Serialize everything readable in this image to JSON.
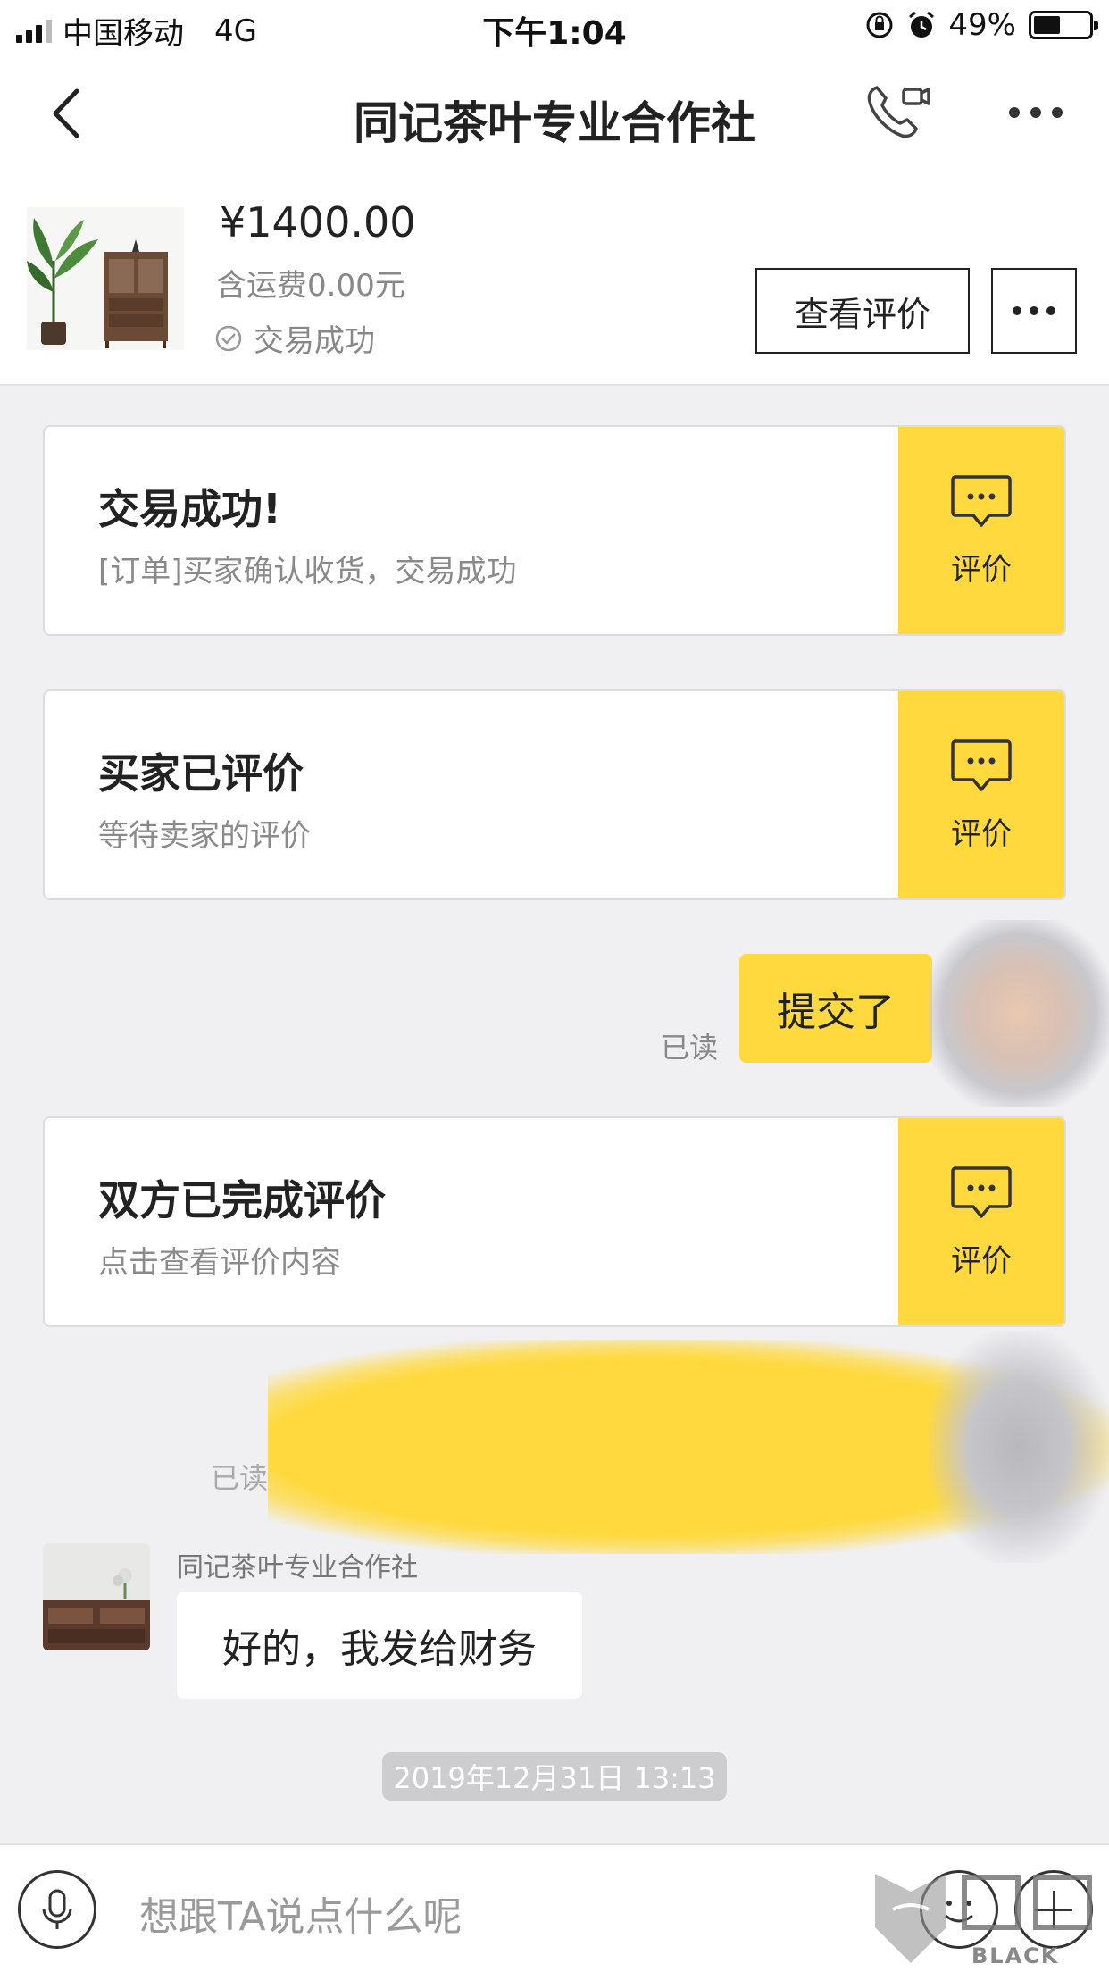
{
  "status_bar": {
    "carrier": "中国移动",
    "network": "4G",
    "time": "下午1:04",
    "battery": "49%",
    "battery_level": 0.49
  },
  "nav": {
    "title": "同记茶叶专业合作社",
    "icons": [
      "back-arrow-icon",
      "phone-video-icon",
      "more-icon"
    ]
  },
  "product": {
    "price": "¥1400.00",
    "shipping": "含运费0.00元",
    "status": "交易成功",
    "review_button": "查看评价"
  },
  "colors": {
    "accent": "#ffd93d",
    "background": "#f0f0f3"
  },
  "cards": [
    {
      "title": "交易成功!",
      "subtitle": "[订单]买家确认收货，交易成功",
      "action": "评价"
    },
    {
      "title": "买家已评价",
      "subtitle": "等待卖家的评价",
      "action": "评价"
    },
    {
      "title": "双方已完成评价",
      "subtitle": "点击查看评价内容",
      "action": "评价"
    }
  ],
  "chat": {
    "my_message": "提交了",
    "read_label": "已读",
    "read_label_2": "已读",
    "sender_name": "同记茶叶专业合作社",
    "other_message": "好的，我发给财务",
    "timestamp": "2019年12月31日 13:13"
  },
  "input": {
    "placeholder": "想跟TA说点什么呢"
  },
  "watermark": {
    "text": "BLACK CAT"
  }
}
